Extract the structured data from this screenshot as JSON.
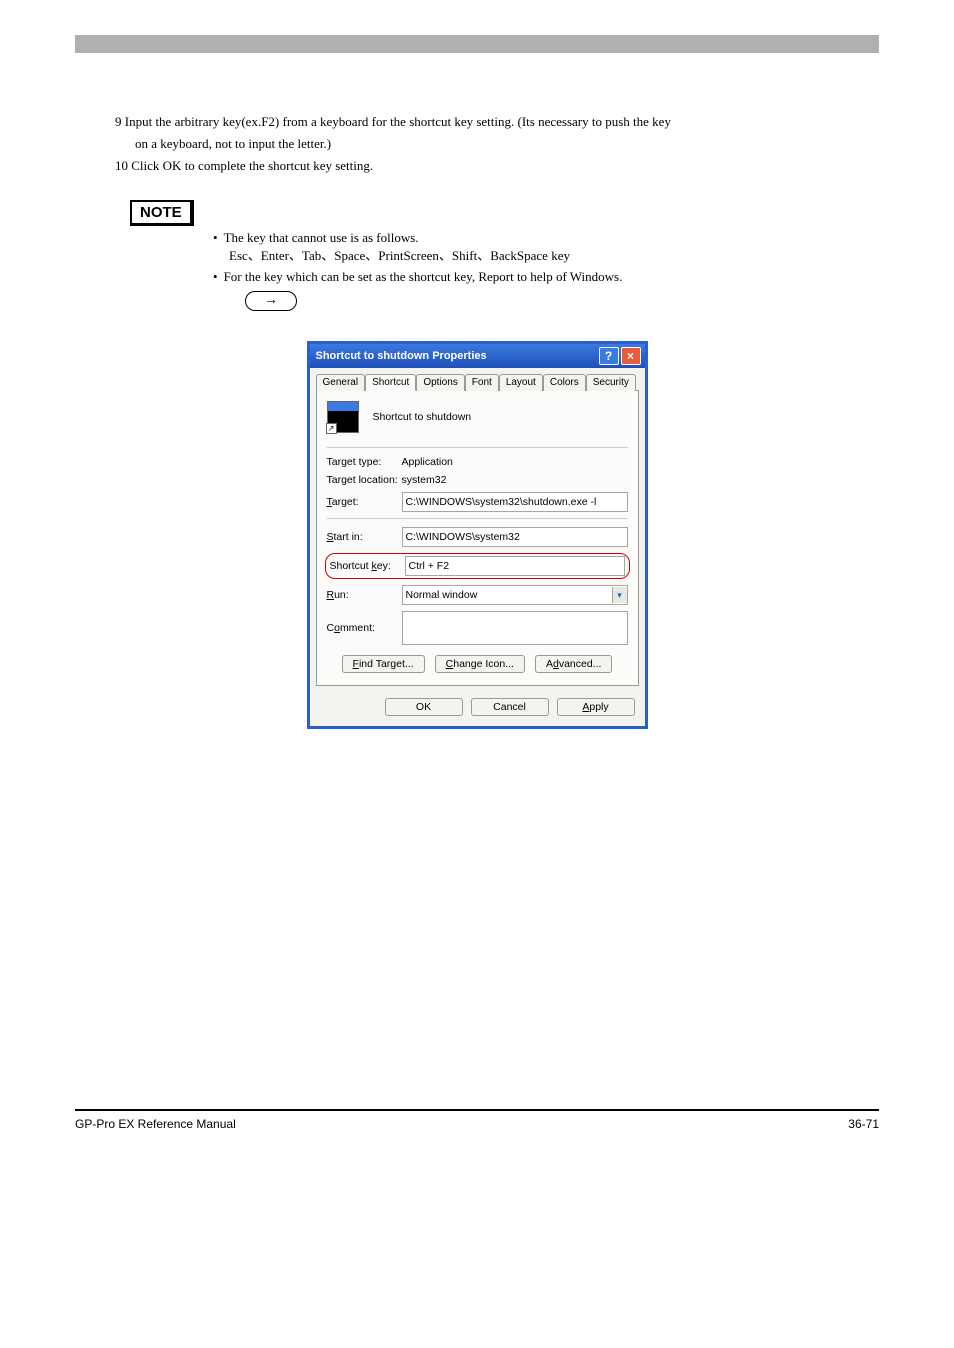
{
  "steps": {
    "s9": "9 Input the arbitrary key(ex.F2) from a keyboard for the shortcut key setting. (Its necessary to push the key",
    "s9b": "on a keyboard, not to input the letter.)",
    "s10": "10 Click OK to complete the shortcut key setting."
  },
  "note": {
    "label": "NOTE",
    "bullet1a": "The key that cannot use is as follows.",
    "bullet1b": "Esc、Enter、Tab、Space、PrintScreen、Shift、BackSpace key",
    "bullet2": "For the key which can be set as the shortcut key, Report to help of Windows.",
    "arrow": "→"
  },
  "dialog": {
    "title": "Shortcut to shutdown Properties",
    "tabs": {
      "general": "General",
      "shortcut": "Shortcut",
      "options": "Options",
      "font": "Font",
      "layout": "Layout",
      "colors": "Colors",
      "security": "Security"
    },
    "icon_label": "Shortcut to shutdown",
    "fields": {
      "target_type_label": "Target type:",
      "target_type_value": "Application",
      "target_location_label": "Target location:",
      "target_location_value": "system32",
      "target_label": "Target:",
      "target_value": "C:\\WINDOWS\\system32\\shutdown.exe -l",
      "start_in_label": "Start in:",
      "start_in_value": "C:\\WINDOWS\\system32",
      "shortcut_key_label": "Shortcut key:",
      "shortcut_key_value": "Ctrl + F2",
      "run_label": "Run:",
      "run_value": "Normal window",
      "comment_label": "Comment:"
    },
    "buttons": {
      "find_target": "Find Target...",
      "change_icon": "Change Icon...",
      "advanced": "Advanced...",
      "ok": "OK",
      "cancel": "Cancel",
      "apply": "Apply"
    }
  },
  "footer": {
    "left": "GP-Pro EX Reference Manual",
    "right": "36-71"
  }
}
